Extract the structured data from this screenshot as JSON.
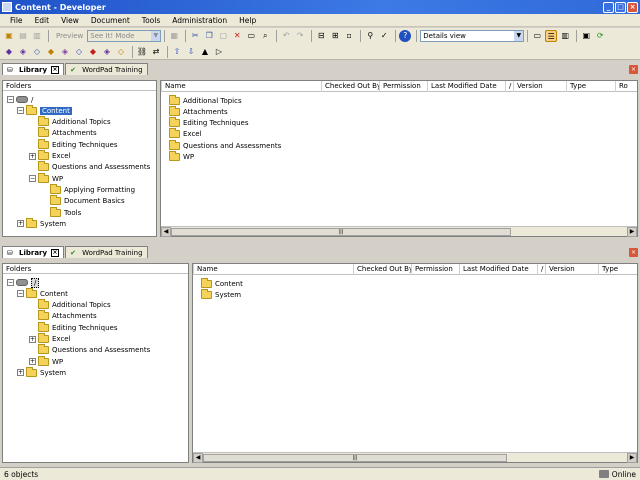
{
  "window": {
    "title": "Content - Developer"
  },
  "menu": [
    "File",
    "Edit",
    "View",
    "Document",
    "Tools",
    "Administration",
    "Help"
  ],
  "toolbar": {
    "preview_label": "Preview",
    "mode_value": "See It! Mode",
    "view_value": "Details view"
  },
  "top_pane": {
    "tabs": [
      {
        "label": "Library"
      },
      {
        "label": "WordPad Training"
      }
    ],
    "folders_header": "Folders",
    "tree": [
      {
        "label": "/",
        "level": 0,
        "expander": "-",
        "root": true
      },
      {
        "label": "Content",
        "level": 1,
        "expander": "-",
        "selected": true
      },
      {
        "label": "Additional Topics",
        "level": 2,
        "expander": ""
      },
      {
        "label": "Attachments",
        "level": 2,
        "expander": ""
      },
      {
        "label": "Editing Techniques",
        "level": 2,
        "expander": ""
      },
      {
        "label": "Excel",
        "level": 2,
        "expander": "+"
      },
      {
        "label": "Questions and Assessments",
        "level": 2,
        "expander": ""
      },
      {
        "label": "WP",
        "level": 2,
        "expander": "-"
      },
      {
        "label": "Applying Formatting",
        "level": 3,
        "expander": ""
      },
      {
        "label": "Document Basics",
        "level": 3,
        "expander": ""
      },
      {
        "label": "Tools",
        "level": 3,
        "expander": ""
      },
      {
        "label": "System",
        "level": 1,
        "expander": "+"
      }
    ],
    "columns": [
      "Name",
      "Checked Out By",
      "Permission",
      "Last Modified Date",
      "/",
      "Version",
      "Type",
      "Ro"
    ],
    "rows": [
      "Additional Topics",
      "Attachments",
      "Editing Techniques",
      "Excel",
      "Questions and Assessments",
      "WP"
    ]
  },
  "bottom_pane": {
    "tabs": [
      {
        "label": "Library"
      },
      {
        "label": "WordPad Training"
      }
    ],
    "folders_header": "Folders",
    "tree": [
      {
        "label": "/",
        "level": 0,
        "expander": "-",
        "root": true
      },
      {
        "label": "Content",
        "level": 1,
        "expander": "-"
      },
      {
        "label": "Additional Topics",
        "level": 2,
        "expander": ""
      },
      {
        "label": "Attachments",
        "level": 2,
        "expander": ""
      },
      {
        "label": "Editing Techniques",
        "level": 2,
        "expander": ""
      },
      {
        "label": "Excel",
        "level": 2,
        "expander": "+"
      },
      {
        "label": "Questions and Assessments",
        "level": 2,
        "expander": ""
      },
      {
        "label": "WP",
        "level": 2,
        "expander": "+"
      },
      {
        "label": "System",
        "level": 1,
        "expander": "+"
      }
    ],
    "columns": [
      "Name",
      "Checked Out By",
      "Permission",
      "Last Modified Date",
      "/",
      "Version",
      "Type"
    ],
    "rows": [
      "Content",
      "System"
    ]
  },
  "status": {
    "left": "6 objects",
    "right": "Online"
  },
  "colors": {
    "selection": "#316ac5",
    "titlebar": "#1f52c8",
    "folder": "#f3d35a"
  }
}
